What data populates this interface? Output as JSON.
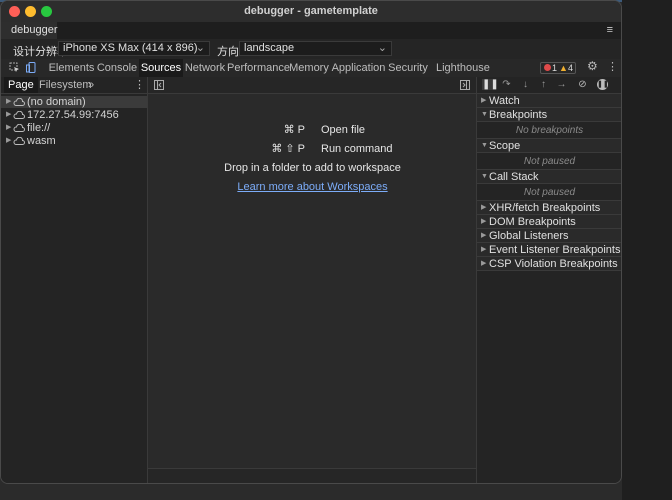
{
  "window": {
    "title": "debugger - gametemplate"
  },
  "app_tabs": [
    {
      "label": "debugger"
    }
  ],
  "device_bar": {
    "resolution_label": "设计分辨率",
    "device_value": "iPhone XS Max (414 x 896)",
    "orientation_label": "方向",
    "orientation_value": "landscape"
  },
  "devtools_tabs": [
    {
      "label": "Elements"
    },
    {
      "label": "Console"
    },
    {
      "label": "Sources"
    },
    {
      "label": "Network"
    },
    {
      "label": "Performance"
    },
    {
      "label": "Memory"
    },
    {
      "label": "Application"
    },
    {
      "label": "Security"
    },
    {
      "label": "Lighthouse"
    }
  ],
  "counts": {
    "errors": "1",
    "warnings": "4"
  },
  "navigator": {
    "tabs": [
      {
        "label": "Page"
      },
      {
        "label": "Filesystem"
      }
    ],
    "more": "»",
    "items": [
      {
        "label": "(no domain)"
      },
      {
        "label": "172.27.54.99:7456"
      },
      {
        "label": "file://"
      },
      {
        "label": "wasm"
      }
    ]
  },
  "editor": {
    "shortcuts": [
      {
        "keys": "⌘ P",
        "label": "Open file"
      },
      {
        "keys": "⌘ ⇧ P",
        "label": "Run command"
      }
    ],
    "drop_text": "Drop in a folder to add to workspace",
    "learn_link": "Learn more about Workspaces"
  },
  "debugger": {
    "watch": "Watch",
    "breakpoints": "Breakpoints",
    "no_breakpoints": "No breakpoints",
    "scope": "Scope",
    "scope_status": "Not paused",
    "call_stack": "Call Stack",
    "call_stack_status": "Not paused",
    "xhr": "XHR/fetch Breakpoints",
    "dom": "DOM Breakpoints",
    "global": "Global Listeners",
    "event": "Event Listener Breakpoints",
    "csp": "CSP Violation Breakpoints"
  },
  "colors": {
    "link": "#7cacf8",
    "error": "#e04a4a",
    "warning": "#f0b030",
    "close": "#fe5f57",
    "minimize": "#febc2e",
    "maximize": "#28c840"
  }
}
